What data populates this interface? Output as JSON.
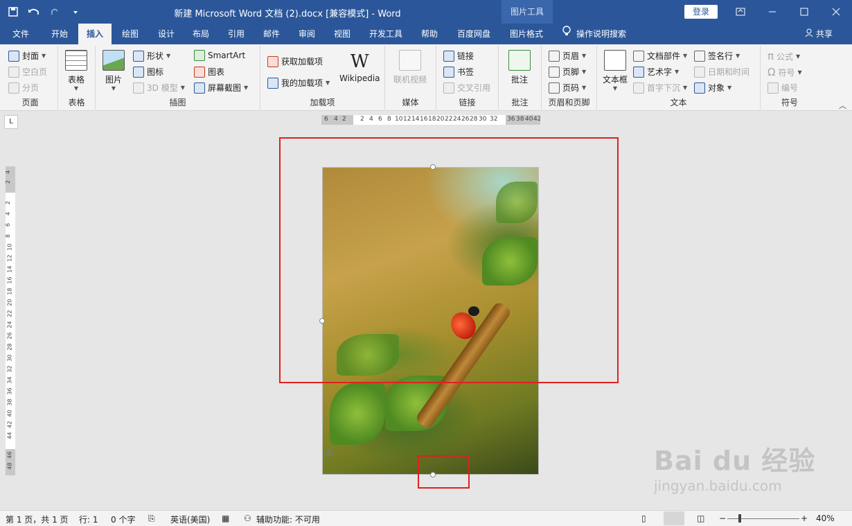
{
  "title_bar": {
    "doc_title": "新建 Microsoft Word 文档 (2).docx [兼容模式]  -  Word",
    "picture_tools_label": "图片工具",
    "login_label": "登录"
  },
  "tabs": [
    {
      "label": "文件"
    },
    {
      "label": "开始"
    },
    {
      "label": "插入"
    },
    {
      "label": "绘图"
    },
    {
      "label": "设计"
    },
    {
      "label": "布局"
    },
    {
      "label": "引用"
    },
    {
      "label": "邮件"
    },
    {
      "label": "审阅"
    },
    {
      "label": "视图"
    },
    {
      "label": "开发工具"
    },
    {
      "label": "帮助"
    },
    {
      "label": "百度网盘"
    },
    {
      "label": "图片格式"
    }
  ],
  "tell_me": "操作说明搜索",
  "share": "共享",
  "ribbon": {
    "pages": {
      "cover": "封面",
      "blank": "空白页",
      "break": "分页",
      "label": "页面"
    },
    "tables": {
      "table": "表格",
      "label": "表格"
    },
    "illustrations": {
      "pictures": "图片",
      "shapes": "形状",
      "icons": "图标",
      "model3d": "3D 模型",
      "smartart": "SmartArt",
      "chart": "图表",
      "screenshot": "屏幕截图",
      "label": "插图"
    },
    "addins": {
      "get": "获取加载项",
      "my": "我的加载项",
      "wikipedia": "Wikipedia",
      "label": "加载项"
    },
    "media": {
      "video": "联机视频",
      "label": "媒体"
    },
    "links": {
      "link": "链接",
      "bookmark": "书签",
      "crossref": "交叉引用",
      "label": "链接"
    },
    "comments": {
      "comment": "批注",
      "label": "批注"
    },
    "header_footer": {
      "header": "页眉",
      "footer": "页脚",
      "page_number": "页码",
      "label": "页眉和页脚"
    },
    "text": {
      "textbox": "文本框",
      "quickparts": "文档部件",
      "wordart": "艺术字",
      "dropcap": "首字下沉",
      "signature": "签名行",
      "datetime": "日期和时间",
      "object": "对象",
      "label": "文本"
    },
    "symbols": {
      "equation": "公式",
      "symbol": "符号",
      "number": "编号",
      "label": "符号"
    }
  },
  "rulers": {
    "horizontal_left": [
      "6",
      "4",
      "2"
    ],
    "horizontal_main": [
      "2",
      "4",
      "6",
      "8",
      "10",
      "12",
      "14",
      "16",
      "18",
      "20",
      "22",
      "24",
      "26",
      "28",
      "30",
      "32"
    ],
    "horizontal_right": [
      "36",
      "38",
      "40",
      "42"
    ],
    "vertical_top": [
      "4",
      "2"
    ],
    "vertical_main": [
      "2",
      "4",
      "6",
      "8",
      "10",
      "12",
      "14",
      "16",
      "18",
      "20",
      "22",
      "24",
      "26",
      "28",
      "30",
      "32",
      "34",
      "36",
      "38",
      "40",
      "42",
      "44"
    ],
    "vertical_bottom": [
      "46",
      "48"
    ]
  },
  "watermark": {
    "brand": "Bai du 经验",
    "url": "jingyan.baidu.com"
  },
  "status": {
    "page": "第 1 页，共 1 页",
    "line": "行: 1",
    "words": "0 个字",
    "language": "英语(美国)",
    "accessibility": "辅助功能: 不可用",
    "zoom": "40%",
    "zoom_level_percent": 40
  }
}
